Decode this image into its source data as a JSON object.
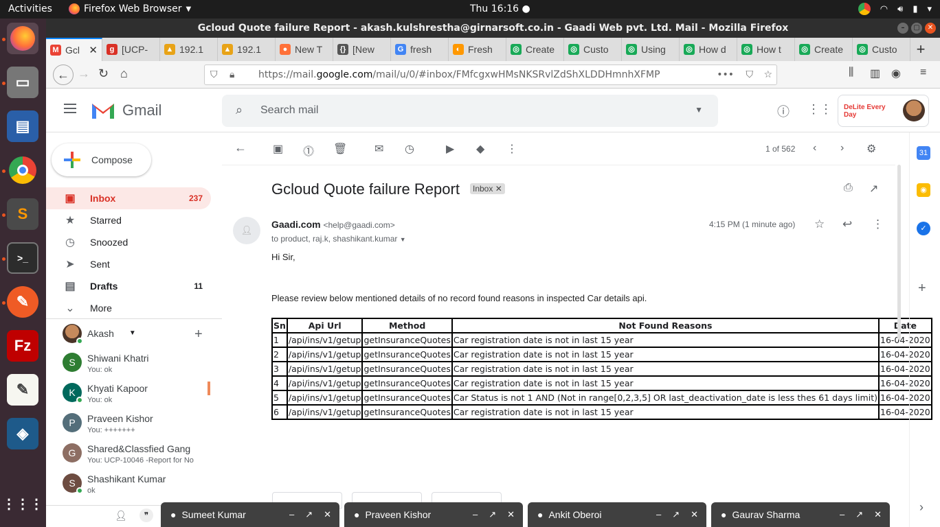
{
  "system": {
    "activities": "Activities",
    "app_name": "Firefox Web Browser",
    "clock": "Thu 16:16"
  },
  "window": {
    "title": "Gcloud Quote failure Report - akash.kulshrestha@girnarsoft.co.in - Gaadi Web pvt. Ltd. Mail - Mozilla Firefox"
  },
  "tabs": [
    {
      "label": "Gcl",
      "color": "#ea4335",
      "glyph": "M"
    },
    {
      "label": "[UCP-",
      "color": "#d93025",
      "glyph": "g"
    },
    {
      "label": "192.1",
      "color": "#e8a317",
      "glyph": "▲"
    },
    {
      "label": "192.1",
      "color": "#e8a317",
      "glyph": "▲"
    },
    {
      "label": "New T",
      "color": "#ff7139",
      "glyph": "●"
    },
    {
      "label": "[New",
      "color": "#555555",
      "glyph": "{}"
    },
    {
      "label": "fresh",
      "color": "#4285f4",
      "glyph": "G"
    },
    {
      "label": "Fresh",
      "color": "#ff9800",
      "glyph": "◐"
    },
    {
      "label": "Create",
      "color": "#18a957",
      "glyph": "◎"
    },
    {
      "label": "Custo",
      "color": "#18a957",
      "glyph": "◎"
    },
    {
      "label": "Using",
      "color": "#18a957",
      "glyph": "◎"
    },
    {
      "label": "How d",
      "color": "#18a957",
      "glyph": "◎"
    },
    {
      "label": "How t",
      "color": "#18a957",
      "glyph": "◎"
    },
    {
      "label": "Create",
      "color": "#18a957",
      "glyph": "◎"
    },
    {
      "label": "Custo",
      "color": "#18a957",
      "glyph": "◎"
    }
  ],
  "url": {
    "prefix": "https://mail.",
    "domain": "google.com",
    "path": "/mail/u/0/#inbox/FMfcgxwHMsNKSRvlZdShXLDDHmnhXFMP"
  },
  "gmail": {
    "brand": "Gmail",
    "search_placeholder": "Search mail",
    "compose": "Compose",
    "account_badge": "DeLite Every Day",
    "nav": [
      {
        "label": "Inbox",
        "count": "237",
        "icon": "inbox-icon",
        "glyph": "▣"
      },
      {
        "label": "Starred",
        "count": "",
        "icon": "star-icon",
        "glyph": "★"
      },
      {
        "label": "Snoozed",
        "count": "",
        "icon": "clock-icon",
        "glyph": "◷"
      },
      {
        "label": "Sent",
        "count": "",
        "icon": "send-icon",
        "glyph": "➤"
      },
      {
        "label": "Drafts",
        "count": "11",
        "icon": "draft-icon",
        "glyph": "▤"
      },
      {
        "label": "More",
        "count": "",
        "icon": "chevron-down-icon",
        "glyph": "⌄"
      }
    ],
    "hangouts_user": "Akash",
    "contacts": [
      {
        "name": "Shiwani Khatri",
        "sub": "You: ok",
        "initial": "S",
        "color": "#2e7d32"
      },
      {
        "name": "Khyati Kapoor",
        "sub": "You: ok",
        "initial": "K",
        "color": "#00695c"
      },
      {
        "name": "Praveen Kishor",
        "sub": "You: +++++++",
        "initial": "P",
        "color": "#546e7a"
      },
      {
        "name": "Shared&Classfied Gang",
        "sub": "You: UCP-10046 -Report for No",
        "initial": "G",
        "color": "#8d6e63"
      },
      {
        "name": "Shashikant Kumar",
        "sub": "ok",
        "initial": "S",
        "color": "#6d4c41"
      }
    ],
    "pagination": "1 of 562"
  },
  "email": {
    "subject": "Gcloud Quote failure Report",
    "label": "Inbox",
    "sender_name": "Gaadi.com",
    "sender_email": "<help@gaadi.com>",
    "to": "to product, raj.k, shashikant.kumar",
    "time": "4:15 PM (1 minute ago)",
    "greeting": "Hi Sir,",
    "intro": "Please review below mentioned details of no record found reasons in inspected Car details api.",
    "table_headers": [
      "Sn",
      "Api Url",
      "Method",
      "Not Found Reasons",
      "Date"
    ],
    "rows": [
      [
        "1",
        "/api/ins/v1/getup",
        "getInsuranceQuotes",
        "Car registration date is not in last 15 year",
        "16-04-2020"
      ],
      [
        "2",
        "/api/ins/v1/getup",
        "getInsuranceQuotes",
        "Car registration date is not in last 15 year",
        "16-04-2020"
      ],
      [
        "3",
        "/api/ins/v1/getup",
        "getInsuranceQuotes",
        "Car registration date is not in last 15 year",
        "16-04-2020"
      ],
      [
        "4",
        "/api/ins/v1/getup",
        "getInsuranceQuotes",
        "Car registration date is not in last 15 year",
        "16-04-2020"
      ],
      [
        "5",
        "/api/ins/v1/getup",
        "getInsuranceQuotes",
        "Car Status is not 1 AND (Not in range[0,2,3,5] OR last_deactivation_date is less thes 61 days limit)",
        "16-04-2020"
      ],
      [
        "6",
        "/api/ins/v1/getup",
        "getInsuranceQuotes",
        "Car registration date is not in last 15 year",
        "16-04-2020"
      ]
    ]
  },
  "chats": [
    "Sumeet Kumar",
    "Praveen Kishor",
    "Ankit Oberoi",
    "Gaurav Sharma"
  ]
}
